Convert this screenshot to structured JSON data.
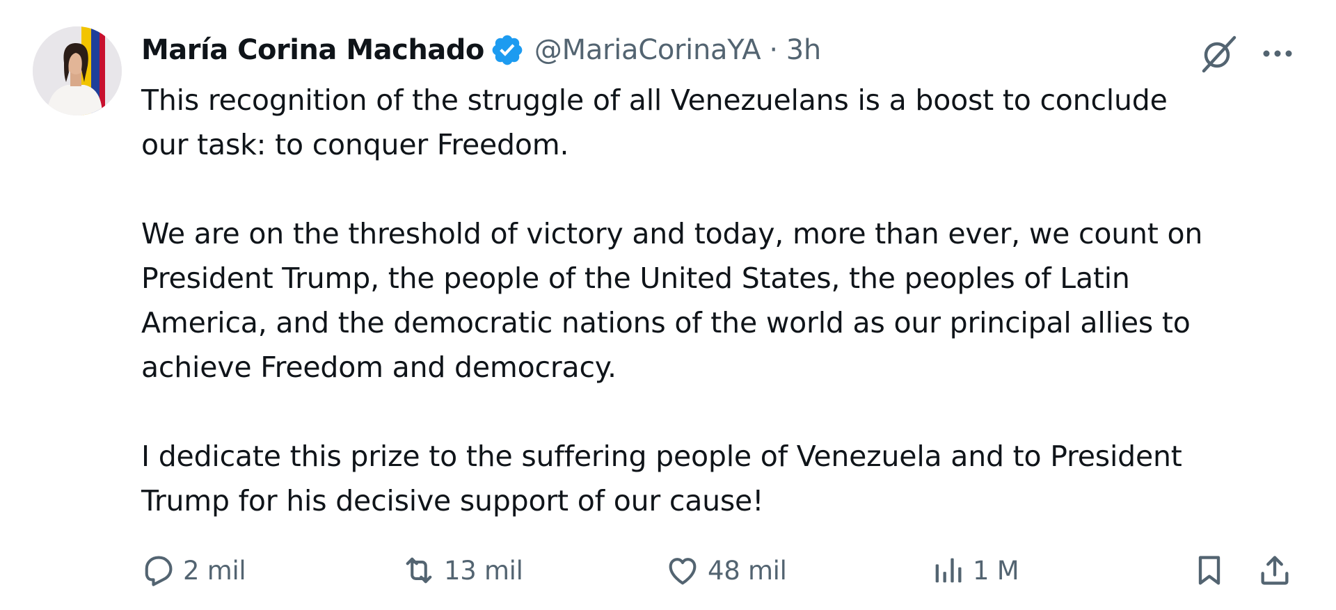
{
  "author": {
    "display_name": "María Corina Machado",
    "handle": "@MariaCorinaYA",
    "separator": "·",
    "time": "3h",
    "avatar": "profile-photo"
  },
  "icons": {
    "verified": "verified-badge-icon",
    "grok": "grok-icon",
    "more": "more-options-icon",
    "reply": "reply-icon",
    "repost": "repost-icon",
    "like": "like-heart-icon",
    "views": "views-analytics-icon",
    "bookmark": "bookmark-icon",
    "share": "share-icon"
  },
  "tweet": {
    "paragraphs": [
      "This recognition of the struggle of all Venezuelans is a boost to conclude\nour task: to conquer Freedom.",
      "We are on the threshold of victory and today, more than ever, we count on\nPresident Trump, the people of the United States, the peoples of Latin\nAmerica, and the democratic nations of the world as our principal allies to\nachieve Freedom and democracy.",
      "I dedicate this prize to the suffering people of Venezuela and to President\nTrump for his decisive support of our cause!"
    ]
  },
  "metrics": {
    "replies": "2 mil",
    "reposts": "13 mil",
    "likes": "48 mil",
    "views": "1 M"
  },
  "colors": {
    "text": "#0f1419",
    "muted": "#536471",
    "verified": "#1d9bf0"
  }
}
